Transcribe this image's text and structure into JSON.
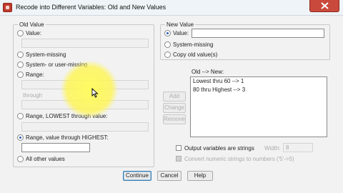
{
  "window": {
    "title": "Recode into Different Variables: Old and New Values"
  },
  "old_value": {
    "legend": "Old Value",
    "value_label": "Value:",
    "system_missing_label": "System-missing",
    "system_or_user_missing_label": "System- or user-missing",
    "range_label": "Range:",
    "through_label": "through",
    "range_lowest_label": "Range, LOWEST through value:",
    "range_highest_label": "Range, value through HIGHEST:",
    "all_other_label": "All other values",
    "selected": "range_highest"
  },
  "new_value": {
    "legend": "New Value",
    "value_label": "Value:",
    "system_missing_label": "System-missing",
    "copy_old_label": "Copy old value(s)",
    "selected": "value"
  },
  "mapping": {
    "list_label": "Old --> New:",
    "items": [
      "Lowest thru 60 --> 1",
      "80 thru Highest --> 3"
    ],
    "add_label": "Add",
    "change_label": "Change",
    "remove_label": "Remove"
  },
  "output_options": {
    "strings_label": "Output variables are strings",
    "width_label": "Width:",
    "width_value": "8",
    "convert_label": "Convert numeric strings to numbers ('5'->5)"
  },
  "footer": {
    "continue_label": "Continue",
    "cancel_label": "Cancel",
    "help_label": "Help"
  },
  "icons": {
    "app": "spss-app-icon",
    "close": "close-icon",
    "cursor": "mouse-pointer-icon"
  },
  "colors": {
    "close_button": "#c94a3c",
    "highlight": "#fff95a",
    "radio_dot": "#2b5fb3"
  }
}
